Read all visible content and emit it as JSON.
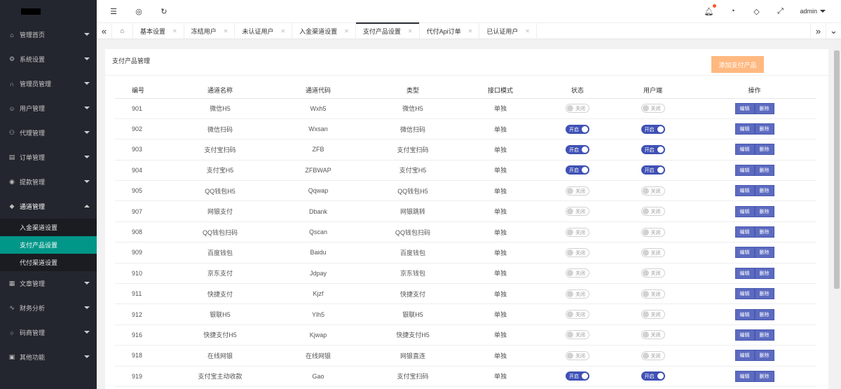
{
  "sidebar": {
    "items": [
      {
        "label": "管理首页",
        "icon": "home-icon",
        "glyph": "⌂"
      },
      {
        "label": "系统设置",
        "icon": "gear-icon",
        "glyph": "⚙"
      },
      {
        "label": "管理员管理",
        "icon": "headset-icon",
        "glyph": "∩"
      },
      {
        "label": "用户管理",
        "icon": "user-icon",
        "glyph": "☺"
      },
      {
        "label": "代理管理",
        "icon": "agent-icon",
        "glyph": "⚇"
      },
      {
        "label": "订单管理",
        "icon": "order-icon",
        "glyph": "▤"
      },
      {
        "label": "提款管理",
        "icon": "withdraw-icon",
        "glyph": "◉"
      },
      {
        "label": "通道管理",
        "icon": "diamond-icon",
        "glyph": "◆"
      }
    ],
    "subitems": [
      {
        "label": "入金渠道设置",
        "active": false
      },
      {
        "label": "支付产品设置",
        "active": true
      },
      {
        "label": "代付渠道设置",
        "active": false
      }
    ],
    "items_after": [
      {
        "label": "文章管理",
        "icon": "article-icon",
        "glyph": "▦"
      },
      {
        "label": "财务分析",
        "icon": "chart-icon",
        "glyph": "∿"
      },
      {
        "label": "码商管理",
        "icon": "circle-icon",
        "glyph": "○"
      },
      {
        "label": "其他功能",
        "icon": "misc-icon",
        "glyph": "▣"
      }
    ]
  },
  "topbar": {
    "user": "admin"
  },
  "tabs": [
    {
      "label": "基本设置",
      "active": false
    },
    {
      "label": "冻结用户",
      "active": false
    },
    {
      "label": "未认证用户",
      "active": false
    },
    {
      "label": "入金渠道设置",
      "active": false
    },
    {
      "label": "支付产品设置",
      "active": true
    },
    {
      "label": "代付Api订单",
      "active": false
    },
    {
      "label": "已认证用户",
      "active": false
    }
  ],
  "panel": {
    "title": "支付产品管理",
    "add_button": "添加支付产品"
  },
  "table": {
    "headers": [
      "编号",
      "通道名称",
      "通道代码",
      "类型",
      "接口模式",
      "状态",
      "用户端",
      "操作"
    ],
    "edit_label": "编辑",
    "delete_label": "删除",
    "on_label": "开启",
    "off_label": "关闭",
    "rows": [
      {
        "id": "901",
        "name": "微信H5",
        "code": "Wxh5",
        "type": "微信H5",
        "mode": "单独",
        "status": false,
        "client": false
      },
      {
        "id": "902",
        "name": "微信扫码",
        "code": "Wxsan",
        "type": "微信扫码",
        "mode": "单独",
        "status": true,
        "client": true
      },
      {
        "id": "903",
        "name": "支付宝扫码",
        "code": "ZFB",
        "type": "支付宝扫码",
        "mode": "单独",
        "status": true,
        "client": true
      },
      {
        "id": "904",
        "name": "支付宝H5",
        "code": "ZFBWAP",
        "type": "支付宝H5",
        "mode": "单独",
        "status": true,
        "client": true
      },
      {
        "id": "905",
        "name": "QQ钱包H5",
        "code": "Qqwap",
        "type": "QQ钱包H5",
        "mode": "单独",
        "status": false,
        "client": false
      },
      {
        "id": "907",
        "name": "网银支付",
        "code": "Dbank",
        "type": "网银跳转",
        "mode": "单独",
        "status": false,
        "client": false
      },
      {
        "id": "908",
        "name": "QQ钱包扫码",
        "code": "Qscan",
        "type": "QQ钱包扫码",
        "mode": "单独",
        "status": false,
        "client": false
      },
      {
        "id": "909",
        "name": "百度钱包",
        "code": "Baidu",
        "type": "百度钱包",
        "mode": "单独",
        "status": false,
        "client": false
      },
      {
        "id": "910",
        "name": "京东支付",
        "code": "Jdpay",
        "type": "京东钱包",
        "mode": "单独",
        "status": false,
        "client": false
      },
      {
        "id": "911",
        "name": "快捷支付",
        "code": "Kjzf",
        "type": "快捷支付",
        "mode": "单独",
        "status": false,
        "client": false
      },
      {
        "id": "912",
        "name": "银联H5",
        "code": "Ylh5",
        "type": "银联H5",
        "mode": "单独",
        "status": false,
        "client": false
      },
      {
        "id": "916",
        "name": "快捷支付H5",
        "code": "Kjwap",
        "type": "快捷支付H5",
        "mode": "单独",
        "status": false,
        "client": false
      },
      {
        "id": "918",
        "name": "在线网银",
        "code": "在线网银",
        "type": "网银直连",
        "mode": "单独",
        "status": false,
        "client": false
      },
      {
        "id": "919",
        "name": "支付宝主动收款",
        "code": "Gao",
        "type": "支付宝扫码",
        "mode": "单独",
        "status": true,
        "client": true
      }
    ]
  }
}
